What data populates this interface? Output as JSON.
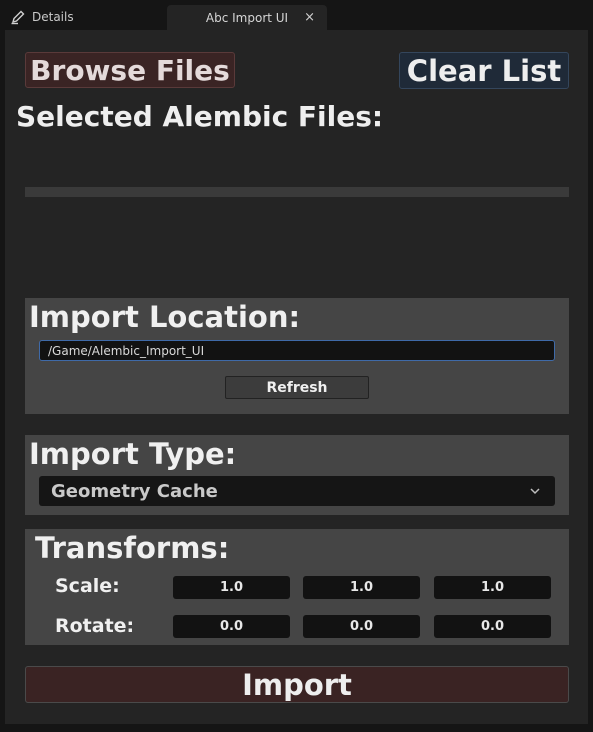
{
  "tabs": {
    "details_label": "Details",
    "active_label": "Abc Import UI",
    "close_glyph": "×"
  },
  "toolbar": {
    "browse_label": "Browse Files",
    "clear_label": "Clear List"
  },
  "files": {
    "title": "Selected Alembic Files:",
    "items": []
  },
  "location": {
    "title": "Import Location:",
    "path_value": "/Game/Alembic_Import_UI",
    "refresh_label": "Refresh"
  },
  "import_type": {
    "title": "Import Type:",
    "selected": "Geometry Cache"
  },
  "transforms": {
    "title": "Transforms:",
    "scale_label": "Scale:",
    "scale": [
      "1.0",
      "1.0",
      "1.0"
    ],
    "rotate_label": "Rotate:",
    "rotate": [
      "0.0",
      "0.0",
      "0.0"
    ]
  },
  "import_label": "Import",
  "colors": {
    "panel": "#242424",
    "section": "#454545",
    "browse_button": "#3a2424",
    "clear_button": "#1f2a38",
    "import_button": "#3a2323",
    "input_focus_border": "#3f6aa8"
  },
  "icons": {
    "details_tab": "pencil-icon",
    "dropdown": "chevron-down-icon"
  }
}
